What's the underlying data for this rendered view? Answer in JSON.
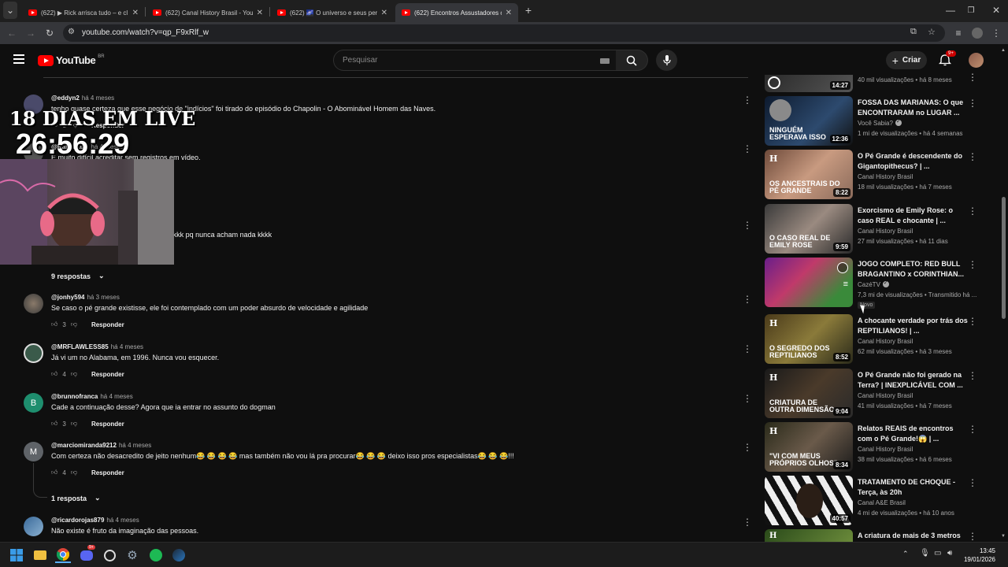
{
  "browser": {
    "tabs": [
      {
        "label": "(622) ▶ Rick arrisca tudo – e cl"
      },
      {
        "label": "(622) Canal History Brasil - YouT"
      },
      {
        "label": "(622) 🌌 O universo e seus per"
      },
      {
        "label": "(622) Encontros Assustadores c"
      }
    ],
    "url": "youtube.com/watch?v=qp_F9xRlf_w"
  },
  "masthead": {
    "logo_text": "YouTube",
    "region": "BR",
    "search_placeholder": "Pesquisar",
    "create_label": "Criar",
    "notif_badge": "9+"
  },
  "overlay": {
    "title": "18 DIAS EM LIVE",
    "timer": "26:56:29"
  },
  "comments": [
    {
      "author": "@eddyn2",
      "time": "há 4 meses",
      "text": "tenho quase certeza que esse negócio de \"indícios\" foi tirado do episódio do Chapolin - O Abominável Homem das Naves.",
      "likes": "1",
      "reply": "Responder",
      "avatar_color": "#4a4a6a",
      "avatar_letter": ""
    },
    {
      "author": "@Ramukaze",
      "time": "há 4 meses",
      "text": "É muito difícil acreditar sem registros em vídeo.",
      "likes": "",
      "reply": "Responder",
      "avatar_color": "#555",
      "avatar_letter": ""
    },
    {
      "author": "",
      "time": "",
      "text": "canal history vai ficar sem conteúdo kkkkk pq nunca acham nada kkkk",
      "likes": "",
      "reply": "",
      "avatar_color": "#555",
      "avatar_letter": ""
    },
    {
      "author": "@jonhy594",
      "time": "há 3 meses",
      "text": "Se caso o pé grande existisse, ele foi contemplado com um poder absurdo de velocidade e agilidade",
      "likes": "3",
      "reply": "Responder",
      "avatar_color": "#5a4a3a",
      "avatar_letter": ""
    },
    {
      "author": "@MRFLAWLESS85",
      "time": "há 4 meses",
      "text": "Já vi um no Alabama, em 1996. Nunca vou esquecer.",
      "likes": "4",
      "reply": "Responder",
      "avatar_color": "#3a5a4a",
      "avatar_letter": ""
    },
    {
      "author": "@brunnofranca",
      "time": "há 4 meses",
      "text": "Cade a continuação desse? Agora que ia entrar no assunto do dogman",
      "likes": "3",
      "reply": "Responder",
      "avatar_color": "#1e8e6e",
      "avatar_letter": "B"
    },
    {
      "author": "@marciomiranda9212",
      "time": "há 4 meses",
      "text": "Com certeza não desacredito de jeito nenhum😂 😂 😂 😂 mas também não vou lá pra procurar😂 😂 😂 deixo isso pros especialistas😂 😂 😂!!!",
      "likes": "4",
      "reply": "Responder",
      "avatar_color": "#5f6368",
      "avatar_letter": "M"
    },
    {
      "author": "@ricardorojas879",
      "time": "há 4 meses",
      "text": "Não existe é fruto da imaginação das pessoas.",
      "likes": "",
      "reply": "",
      "avatar_color": "#3a6a9a",
      "avatar_letter": ""
    }
  ],
  "replies_toggles": [
    {
      "label": "9 respostas"
    },
    {
      "label": "1 resposta"
    }
  ],
  "sidebar": [
    {
      "title": "",
      "channel": "",
      "meta": "40 mil visualizações • há 8 meses",
      "duration": "14:27",
      "overlay": "",
      "bg": "linear-gradient(135deg,#2a2a2a,#555)"
    },
    {
      "title": "FOSSA DAS MARIANAS: O que ENCONTRARAM no LUGAR ...",
      "channel": "Você Sabia?",
      "meta": "1 mi de visualizações • há 4 semanas",
      "duration": "12:36",
      "overlay": "NINGUÉM ESPERAVA ISSO",
      "bg": "linear-gradient(135deg,#0d1a2e,#2d4a6e 60%,#111)"
    },
    {
      "title": "O Pé Grande é descendente do Gigantopithecus? | ...",
      "channel": "Canal History Brasil",
      "meta": "18 mil visualizações • há 7 meses",
      "duration": "8:22",
      "overlay": "OS ANCESTRAIS DO PÉ GRANDE",
      "bg": "linear-gradient(135deg,#6e4a3a,#c89a80 50%,#8a6a5a)"
    },
    {
      "title": "Exorcismo de Emily Rose: o caso REAL e chocante | ...",
      "channel": "Canal History Brasil",
      "meta": "27 mil visualizações • há 11 dias",
      "duration": "9:59",
      "overlay": "O CASO REAL DE EMILY ROSE",
      "bg": "linear-gradient(135deg,#3a3a3a,#9a8a80 50%,#2a2a2a)"
    },
    {
      "title": "JOGO COMPLETO: RED BULL BRAGANTINO x CORINTHIAN...",
      "channel": "CazéTV",
      "meta": "7,3 mi de visualizações • Transmitido há ...",
      "duration": "",
      "overlay": "",
      "bg": "linear-gradient(135deg,#6a1e8a,#c03a6a 40%,#3a8a3a 80%)"
    },
    {
      "title": "A chocante verdade por trás dos REPTILIANOS! | ...",
      "channel": "Canal History Brasil",
      "meta": "62 mil visualizações • há 3 meses",
      "duration": "8:52",
      "overlay": "O SEGREDO DOS REPTILIANOS",
      "bg": "linear-gradient(135deg,#4a3a1a,#8a7a3a 50%,#2a2a1a)"
    },
    {
      "title": "O Pé Grande não foi gerado na Terra? | INEXPLICÁVEL COM ...",
      "channel": "Canal History Brasil",
      "meta": "41 mil visualizações • há 7 meses",
      "duration": "9:04",
      "overlay": "CRIATURA DE OUTRA DIMENSÃO",
      "bg": "linear-gradient(135deg,#1a1a1a,#4a3a2a 50%,#2a2a2a)"
    },
    {
      "title": "Relatos REAIS de encontros com o Pé Grande!😱 | ...",
      "channel": "Canal History Brasil",
      "meta": "38 mil visualizações • há 6 meses",
      "duration": "8:34",
      "overlay": "\"VI COM MEUS PRÓPRIOS OLHOS\"",
      "bg": "linear-gradient(135deg,#2a2a1a,#6a5a4a 50%,#1a1a1a)"
    },
    {
      "title": "TRATAMENTO DE CHOQUE - Terça, às 20h",
      "channel": "Canal A&E Brasil",
      "meta": "4 mi de visualizações • há 10 anos",
      "duration": "40:57",
      "overlay": "",
      "bg": "repeating-linear-gradient(60deg,#111 0 8px,#eee 8px 16px)"
    },
    {
      "title": "A criatura de mais de 3 metros",
      "channel": "",
      "meta": "",
      "duration": "",
      "overlay": "",
      "bg": "linear-gradient(135deg,#2a4a1a,#6a8a3a)"
    }
  ],
  "sidebar_badge_new": "Novo",
  "clock": {
    "time": "13:45",
    "date": "19/01/2026"
  }
}
